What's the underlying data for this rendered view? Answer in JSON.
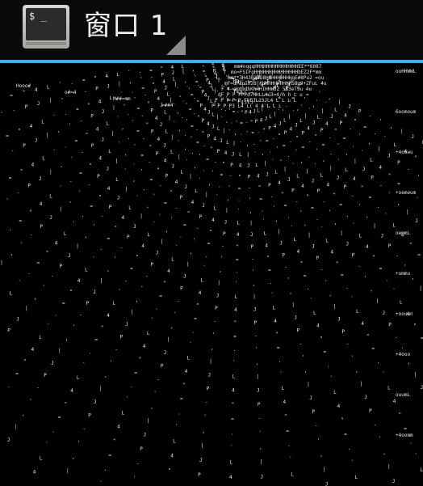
{
  "window": {
    "title": "窗口 1",
    "icon": "terminal-app-icon",
    "icon_glyph": "$ _"
  },
  "colors": {
    "accent": "#33b5e5",
    "background": "#000000",
    "terminal_text": "#e8e8e8"
  },
  "terminal": {
    "content_description_glyphs": "ASCII-art rendered terminal output",
    "top_rows": [
      "mm#oqqqHHHHHHHHHHHHHHHEE**6087",
      "mo=FSIFgHHHHHHHHHHHHHHHbEZ2F*mm",
      "mm**3H43P34D8HHHHHHHHHgE#8Pu2 =ou",
      "mF=dF3pIH2BjKHHHHHHHHHHSBp9+ZFuL 4u",
      "F 4 aHd9dhKhHHIHHH3Z 5B3eT9u 4u",
      "dF P P PPPd7MHLL4u3=4/h h L u",
      "P P P P P FDEJL13JL4 L L L L",
      "P P P P3 L4 L( 4 4 L L L"
    ],
    "right_edge_tokens": [
      "ooHHWWL",
      "6oomoum",
      "+4oowu",
      "+oemoum",
      "oemmL",
      "+ummu",
      "+oouun",
      "+4ooo",
      "ouumL",
      "+4oomm"
    ],
    "left_edge_tokens": [
      "Hooo#",
      "o#=4",
      "M##=mm",
      "=##4"
    ]
  }
}
